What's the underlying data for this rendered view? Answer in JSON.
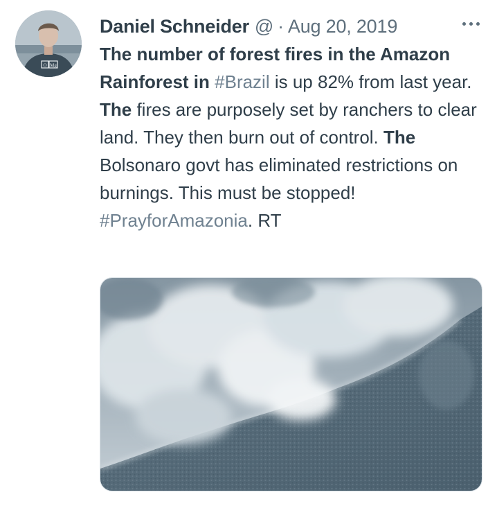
{
  "tweet": {
    "author_name": "Daniel Schneider",
    "author_handle": "@",
    "separator": "·",
    "date": "Aug 20, 2019",
    "more_icon": "ellipsis-icon",
    "avatar_shirt_text": "O Mg",
    "text_segments": [
      {
        "text": "The number of forest fires in the Amazon Rainforest in ",
        "style": "bold"
      },
      {
        "text": "#Brazil",
        "style": "hashtag"
      },
      {
        "text": " is up 82% from last year. ",
        "style": "normal"
      },
      {
        "text": "The",
        "style": "bold"
      },
      {
        "text": " fires are purposely set by ranchers to clear land. They then burn out of control. ",
        "style": "normal"
      },
      {
        "text": "The",
        "style": "bold"
      },
      {
        "text": " Bolsonaro govt has eliminated restrictions on burnings. This must be stopped! ",
        "style": "normal"
      },
      {
        "text": "#PrayforAmazonia",
        "style": "hashtag"
      },
      {
        "text": ". RT",
        "style": "normal"
      }
    ]
  },
  "colors": {
    "text": "#2f3e49",
    "muted": "#5e6f7c",
    "hashtag": "#6f8190",
    "border": "#dbe2e7"
  }
}
